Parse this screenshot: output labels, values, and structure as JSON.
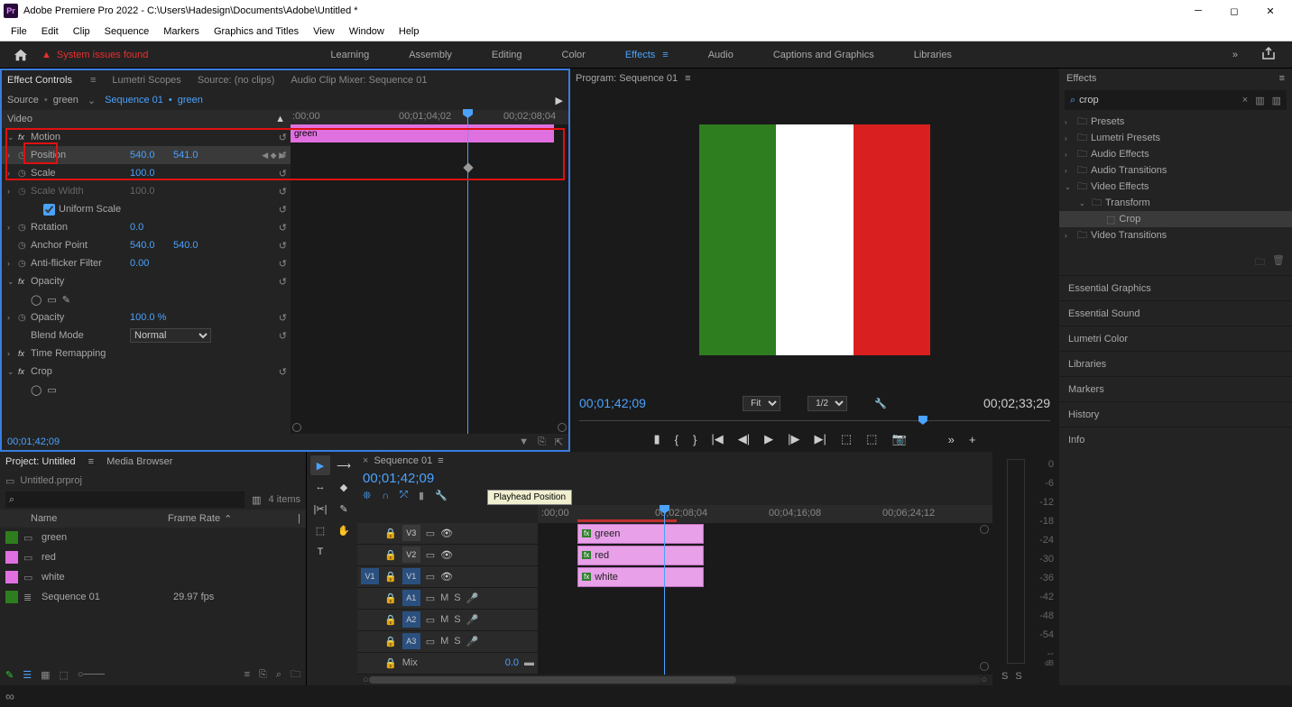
{
  "title": "Adobe Premiere Pro 2022 - C:\\Users\\Hadesign\\Documents\\Adobe\\Untitled *",
  "menu": [
    "File",
    "Edit",
    "Clip",
    "Sequence",
    "Markers",
    "Graphics and Titles",
    "View",
    "Window",
    "Help"
  ],
  "system_warning": "System issues found",
  "workspaces": [
    "Learning",
    "Assembly",
    "Editing",
    "Color",
    "Effects",
    "Audio",
    "Captions and Graphics",
    "Libraries"
  ],
  "workspace_active": "Effects",
  "panel_tabs": {
    "effect_controls": "Effect Controls",
    "lumetri": "Lumetri Scopes",
    "source": "Source: (no clips)",
    "mixer": "Audio Clip Mixer: Sequence 01"
  },
  "source_line": {
    "src": "Source",
    "clip": "green",
    "seq": "Sequence 01",
    "seqclip": "green"
  },
  "ec_header": "Video",
  "ec_ruler": {
    "t0": ":00;00",
    "t1": "00;01;04;02",
    "t2": "00;02;08;04"
  },
  "ec_clip": "green",
  "motion": {
    "label": "Motion",
    "position": {
      "label": "Position",
      "x": "540.0",
      "y": "541.0"
    },
    "scale": {
      "label": "Scale",
      "v": "100.0"
    },
    "scale_width": {
      "label": "Scale Width",
      "v": "100.0"
    },
    "uniform": "Uniform Scale",
    "rotation": {
      "label": "Rotation",
      "v": "0.0"
    },
    "anchor": {
      "label": "Anchor Point",
      "x": "540.0",
      "y": "540.0"
    },
    "flicker": {
      "label": "Anti-flicker Filter",
      "v": "0.00"
    }
  },
  "opacity": {
    "label": "Opacity",
    "value": {
      "label": "Opacity",
      "v": "100.0 %"
    },
    "blend": {
      "label": "Blend Mode",
      "v": "Normal"
    }
  },
  "time_remap": "Time Remapping",
  "crop": "Crop",
  "ec_time": "00;01;42;09",
  "program": {
    "title": "Program: Sequence 01",
    "time": "00;01;42;09",
    "fit": "Fit",
    "res": "1/2",
    "dur": "00;02;33;29"
  },
  "effects_panel": {
    "title": "Effects",
    "search": "crop",
    "tree": [
      {
        "label": "Presets",
        "chev": "›",
        "indent": 0
      },
      {
        "label": "Lumetri Presets",
        "chev": "›",
        "indent": 0
      },
      {
        "label": "Audio Effects",
        "chev": "›",
        "indent": 0
      },
      {
        "label": "Audio Transitions",
        "chev": "›",
        "indent": 0
      },
      {
        "label": "Video Effects",
        "chev": "⌄",
        "indent": 0
      },
      {
        "label": "Transform",
        "chev": "⌄",
        "indent": 1
      },
      {
        "label": "Crop",
        "chev": "",
        "indent": 2,
        "sel": true,
        "icon": "fx"
      },
      {
        "label": "Video Transitions",
        "chev": "›",
        "indent": 0
      }
    ]
  },
  "side_panels": [
    "Essential Graphics",
    "Essential Sound",
    "Lumetri Color",
    "Libraries",
    "Markers",
    "History",
    "Info"
  ],
  "project": {
    "tab1": "Project: Untitled",
    "tab2": "Media Browser",
    "file": "Untitled.prproj",
    "count": "4 items",
    "cols": {
      "name": "Name",
      "fr": "Frame Rate"
    },
    "rows": [
      {
        "color": "#2e7d1e",
        "name": "green",
        "fr": ""
      },
      {
        "color": "#e070e0",
        "name": "red",
        "fr": ""
      },
      {
        "color": "#e070e0",
        "name": "white",
        "fr": ""
      },
      {
        "color": "#2e7d1e",
        "name": "Sequence 01",
        "fr": "29.97 fps",
        "seq": true
      }
    ]
  },
  "timeline": {
    "seq": "Sequence 01",
    "time": "00;01;42;09",
    "tooltip": "Playhead Position",
    "ruler": {
      "t0": ":00;00",
      "t1": "00;02;08;04",
      "t2": "00;04;16;08",
      "t3": "00;06;24;12"
    },
    "tracks": {
      "v3": "V3",
      "v2": "V2",
      "v1": "V1",
      "a1": "A1",
      "a2": "A2",
      "a3": "A3",
      "mix": "Mix",
      "m": "M",
      "s": "S"
    },
    "mixval": "0.0",
    "clips": {
      "green": "green",
      "red": "red",
      "white": "white"
    }
  },
  "meter": {
    "db": "dB",
    "vals": [
      "0",
      "-6",
      "-12",
      "-18",
      "-24",
      "-30",
      "-36",
      "-42",
      "-48",
      "-54",
      "--"
    ],
    "s": "S"
  }
}
